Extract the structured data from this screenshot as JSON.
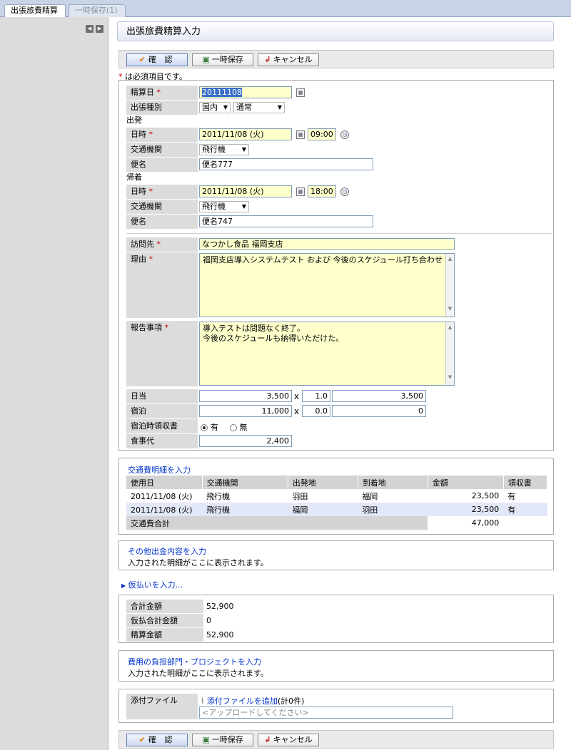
{
  "tabs": [
    {
      "label": "出張旅費精算"
    },
    {
      "label": "一時保存(1)"
    }
  ],
  "page": {
    "title": "出張旅費精算入力"
  },
  "buttons": {
    "confirm": "確 認",
    "save": "一時保存",
    "cancel": "キャンセル"
  },
  "required_note": {
    "mark": "*",
    "text": "は必須項目です。"
  },
  "form": {
    "settle_date": {
      "label": "精算日",
      "value": "20111108"
    },
    "trip_type": {
      "label": "出張種別",
      "domestic": "国内",
      "kind": "通常"
    },
    "departure": {
      "heading": "出発",
      "datetime_label": "日時",
      "date": "2011/11/08 (火)",
      "time": "09:00",
      "transport_label": "交通機関",
      "transport": "飛行機",
      "flight_label": "便名",
      "flight": "便名777"
    },
    "return": {
      "heading": "帰着",
      "datetime_label": "日時",
      "date": "2011/11/08 (火)",
      "time": "18:00",
      "transport_label": "交通機関",
      "transport": "飛行機",
      "flight_label": "便名",
      "flight": "便名747"
    },
    "visit": {
      "label": "訪問先",
      "value": "なつかし食品 福岡支店"
    },
    "reason": {
      "label": "理由",
      "value": "福岡支店導入システムテスト および 今後のスケジュール打ち合わせ"
    },
    "report": {
      "label": "報告事項",
      "line1": "導入テストは問題なく終了。",
      "line2": "今後のスケジュールも納得いただけた。"
    },
    "daily": {
      "label": "日当",
      "amount": "3,500",
      "mult": "x",
      "qty": "1.0",
      "total": "3,500"
    },
    "lodging": {
      "label": "宿泊",
      "amount": "11,000",
      "mult": "x",
      "qty": "0.0",
      "total": "0"
    },
    "receipt": {
      "label": "宿泊時領収書",
      "yes": "有",
      "no": "無"
    },
    "meal": {
      "label": "食事代",
      "value": "2,400"
    }
  },
  "transport": {
    "link": "交通費明細を入力",
    "headers": [
      "使用日",
      "交通機関",
      "出発地",
      "到着地",
      "金額",
      "領収書"
    ],
    "rows": [
      [
        "2011/11/08 (火)",
        "飛行機",
        "羽田",
        "福岡",
        "23,500",
        "有"
      ],
      [
        "2011/11/08 (火)",
        "飛行機",
        "福岡",
        "羽田",
        "23,500",
        "有"
      ]
    ],
    "total_label": "交通費合計",
    "total": "47,000"
  },
  "other": {
    "link": "その他出金内容を入力",
    "text": "入力された明細がここに表示されます。"
  },
  "advance": {
    "link": "仮払いを入力..."
  },
  "summary": {
    "total_label": "合計金額",
    "total": "52,900",
    "advance_label": "仮払合計金額",
    "advance": "0",
    "settle_label": "精算金額",
    "settle": "52,900"
  },
  "cost": {
    "link": "費用の負担部門・プロジェクトを入力",
    "text": "入力された明細がここに表示されます。"
  },
  "attach": {
    "label": "添付ファイル",
    "link": "添付ファイルを追加",
    "count": "(計0件)",
    "placeholder": "<アップロードしてください>"
  },
  "colors": {
    "link": "#0033cc",
    "required": "#cc0000",
    "input_required_bg": "#ffffcc"
  }
}
